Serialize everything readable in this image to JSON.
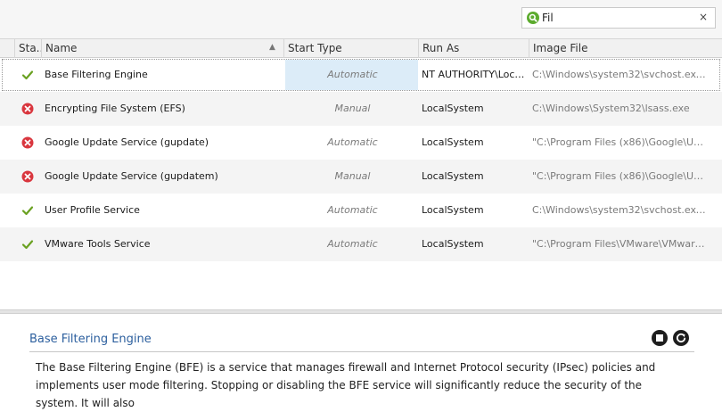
{
  "search": {
    "value": "Fil",
    "clear_glyph": "×",
    "icon": "search-icon"
  },
  "columns": {
    "status": "Sta...",
    "name": "Name",
    "start_type": "Start Type",
    "run_as": "Run As",
    "image_file": "Image File"
  },
  "services": [
    {
      "status": "running",
      "name": "Base Filtering Engine",
      "start_type": "Automatic",
      "run_as": "NT AUTHORITY\\LocalS...",
      "image_file": "C:\\Windows\\system32\\svchost.exe -..."
    },
    {
      "status": "stopped",
      "name": "Encrypting File System (EFS)",
      "start_type": "Manual",
      "run_as": "LocalSystem",
      "image_file": "C:\\Windows\\System32\\lsass.exe"
    },
    {
      "status": "stopped",
      "name": "Google Update Service (gupdate)",
      "start_type": "Automatic",
      "run_as": "LocalSystem",
      "image_file": "\"C:\\Program Files (x86)\\Google\\Upd..."
    },
    {
      "status": "stopped",
      "name": "Google Update Service (gupdatem)",
      "start_type": "Manual",
      "run_as": "LocalSystem",
      "image_file": "\"C:\\Program Files (x86)\\Google\\Upd..."
    },
    {
      "status": "running",
      "name": "User Profile Service",
      "start_type": "Automatic",
      "run_as": "LocalSystem",
      "image_file": "C:\\Windows\\system32\\svchost.exe -..."
    },
    {
      "status": "running",
      "name": "VMware Tools Service",
      "start_type": "Automatic",
      "run_as": "LocalSystem",
      "image_file": "\"C:\\Program Files\\VMware\\VMware ..."
    }
  ],
  "details": {
    "title": "Base Filtering Engine",
    "description": "The Base Filtering Engine (BFE) is a service that manages firewall and Internet Protocol security (IPsec) policies and implements user mode filtering. Stopping or disabling the BFE service will significantly reduce the security of the system. It will also",
    "actions": [
      "stop-icon",
      "restart-icon"
    ]
  },
  "colors": {
    "running": "#6aa121",
    "stopped": "#d9363e",
    "accent": "#2c5f9e",
    "selection": "#dcecf8"
  }
}
